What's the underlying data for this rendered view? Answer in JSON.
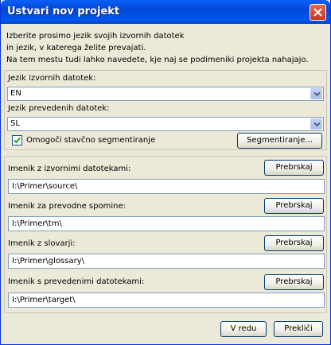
{
  "window": {
    "title": "Ustvari nov projekt"
  },
  "intro": {
    "line1": "Izberite prosimo jezik  svojih izvornih datotek",
    "line2": "in jezik,  v katerega želite prevajati.",
    "line3": "Na tem mestu tudi lahko navedete, kje naj se podimeniki projekta nahajajo."
  },
  "languages": {
    "source_label": "Jezik izvornih datotek:",
    "source_value": "EN",
    "target_label": "Jezik prevedenih datotek:",
    "target_value": "SL",
    "segmentation_checkbox_label": "Omogoči stavčno segmentiranje",
    "segmentation_checked": true,
    "segmentation_button": "Segmentiranje..."
  },
  "folders": {
    "browse_label": "Prebrskaj",
    "source_label": "Imenik z izvornimi datotekami:",
    "source_value": "I:\\Primer\\source\\",
    "tm_label": "Imenik za prevodne spomine:",
    "tm_value": "I:\\Primer\\tm\\",
    "glossary_label": "Imenik z slovarji:",
    "glossary_value": "I:\\Primer\\glossary\\",
    "target_label": "Imenik s prevedenimi datotekami:",
    "target_value": "I:\\Primer\\target\\"
  },
  "footer": {
    "ok_label": "V redu",
    "cancel_label": "Prekliči"
  }
}
